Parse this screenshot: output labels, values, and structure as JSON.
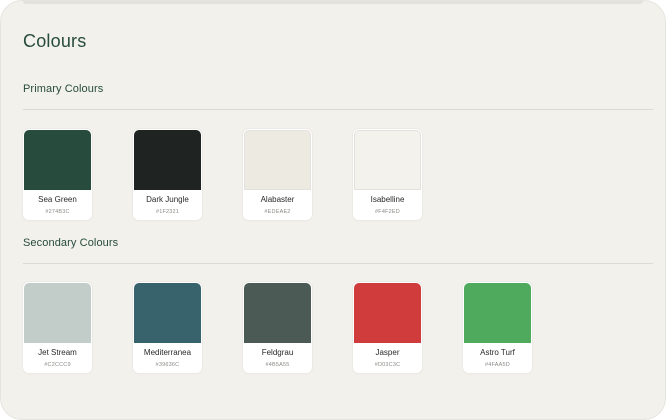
{
  "page": {
    "title": "Colours"
  },
  "primary": {
    "title": "Primary Colours",
    "swatches": [
      {
        "name": "Sea Green",
        "hex": "#274B3C",
        "color": "#274B3C"
      },
      {
        "name": "Dark Jungle",
        "hex": "#1F2321",
        "color": "#1F2321"
      },
      {
        "name": "Alabaster",
        "hex": "#EDEAE2",
        "color": "#EDEAE2"
      },
      {
        "name": "Isabelline",
        "hex": "#F4F2ED",
        "color": "#F4F2ED"
      }
    ]
  },
  "secondary": {
    "title": "Secondary Colours",
    "swatches": [
      {
        "name": "Jet Stream",
        "hex": "#C2CCC9",
        "color": "#C2CCC9"
      },
      {
        "name": "Mediterranea",
        "hex": "#39636C",
        "color": "#39636C"
      },
      {
        "name": "Feldgrau",
        "hex": "#4B5A55",
        "color": "#4B5A55"
      },
      {
        "name": "Jasper",
        "hex": "#D03C3C",
        "color": "#D03C3C"
      },
      {
        "name": "Astro Turf",
        "hex": "#4FAA5D",
        "color": "#4FAA5D"
      }
    ]
  },
  "colors": {
    "background": "#F2F1EC",
    "heading": "#274B3C"
  }
}
